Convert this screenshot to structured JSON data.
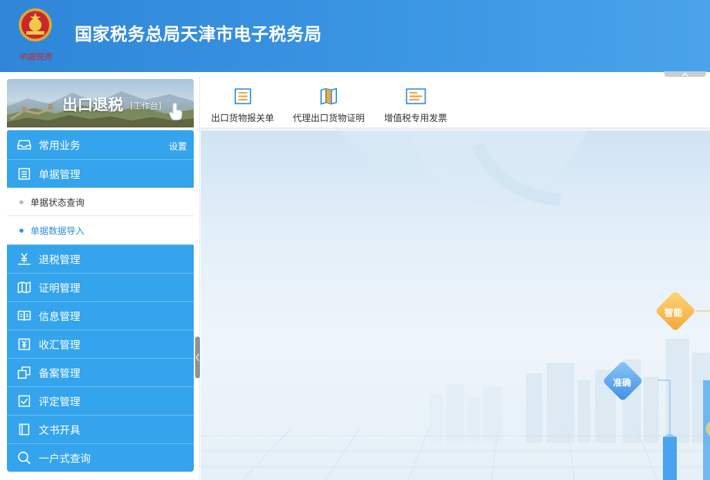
{
  "header": {
    "title": "国家税务总局天津市电子税务局",
    "emblem_caption": "中国税务"
  },
  "sidebar": {
    "banner_title": "出口退税",
    "banner_subtitle": "[工作台]",
    "settings_label": "设置",
    "items": [
      {
        "label": "常用业务",
        "icon": "inbox-icon"
      },
      {
        "label": "单据管理",
        "icon": "document-list-icon"
      },
      {
        "label": "退税管理",
        "icon": "yuan-tray-icon"
      },
      {
        "label": "证明管理",
        "icon": "map-icon"
      },
      {
        "label": "信息管理",
        "icon": "open-book-icon"
      },
      {
        "label": "收汇管理",
        "icon": "yuan-box-icon"
      },
      {
        "label": "备案管理",
        "icon": "copy-icon"
      },
      {
        "label": "评定管理",
        "icon": "checkbox-icon"
      },
      {
        "label": "文书开具",
        "icon": "book-icon"
      },
      {
        "label": "一户式查询",
        "icon": "search-icon"
      }
    ],
    "subitems": [
      {
        "label": "单据状态查询",
        "active": false
      },
      {
        "label": "单据数据导入",
        "active": true
      }
    ]
  },
  "toolbar": {
    "items": [
      {
        "label": "出口货物报关单",
        "icon": "declaration-form-icon"
      },
      {
        "label": "代理出口货物证明",
        "icon": "folded-map-icon"
      },
      {
        "label": "增值税专用发票",
        "icon": "invoice-icon"
      }
    ]
  },
  "main": {
    "badges": [
      {
        "label": "智能",
        "color": "#f7b84b"
      },
      {
        "label": "准确",
        "color": "#5aa6f0"
      }
    ]
  },
  "colors": {
    "header_blue": "#3a95e3",
    "nav_blue": "#34a5ec",
    "active_text": "#2e8fd8",
    "icon_orange": "#f5a53c"
  }
}
